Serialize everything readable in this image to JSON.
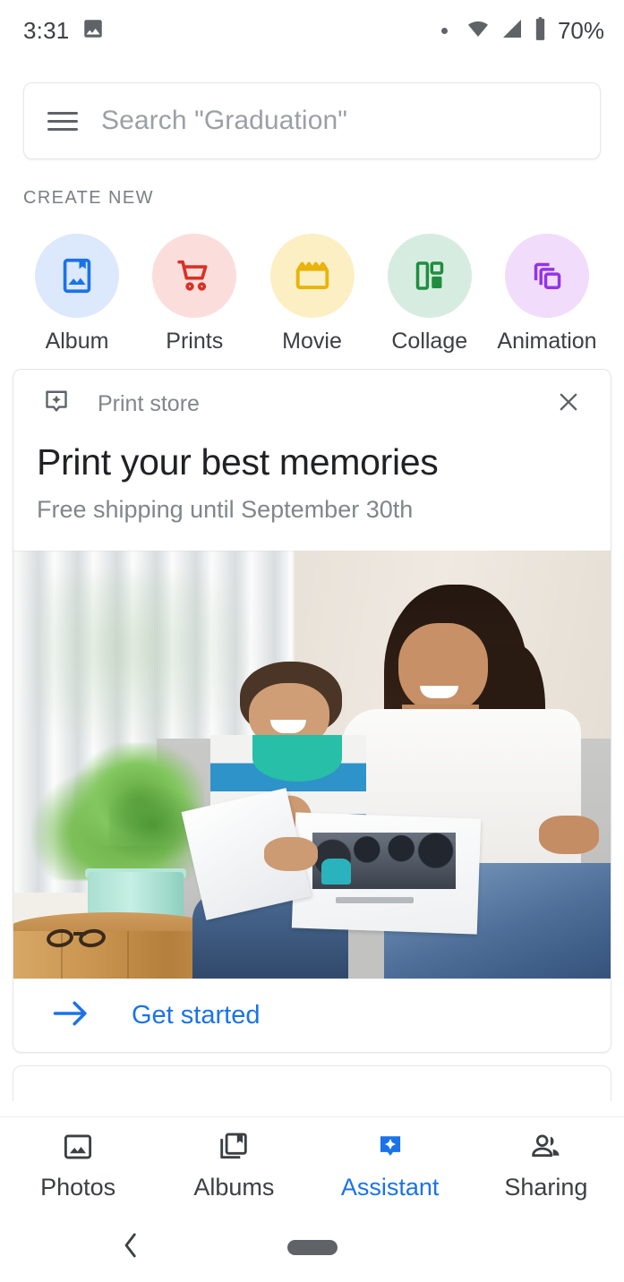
{
  "status_bar": {
    "time": "3:31",
    "photo_icon": "image-icon",
    "dot_indicator": "dot-icon",
    "wifi_icon": "wifi-icon",
    "signal_icon": "cell-signal-icon",
    "battery_icon": "battery-icon",
    "battery_percent": "70%"
  },
  "search": {
    "menu_icon": "hamburger-menu-icon",
    "placeholder": "Search \"Graduation\""
  },
  "create_new": {
    "section_label": "CREATE NEW",
    "items": [
      {
        "label": "Album",
        "icon": "album-bookmark-icon",
        "bg": "#dce8fb",
        "fg": "#1a73e8"
      },
      {
        "label": "Prints",
        "icon": "shopping-cart-icon",
        "bg": "#fbdedc",
        "fg": "#d93025"
      },
      {
        "label": "Movie",
        "icon": "clapperboard-icon",
        "bg": "#fdefc4",
        "fg": "#eab308"
      },
      {
        "label": "Collage",
        "icon": "collage-grid-icon",
        "bg": "#d7ece0",
        "fg": "#1e8e3e"
      },
      {
        "label": "Animation",
        "icon": "stacked-frames-icon",
        "bg": "#f1dcfb",
        "fg": "#9334e6"
      }
    ]
  },
  "card": {
    "source_icon": "assistant-badge-outline-icon",
    "source": "Print store",
    "close_icon": "close-icon",
    "title": "Print your best memories",
    "subtitle": "Free shipping until September 30th",
    "photo_alt": "Woman and boy sitting on a gray sofa looking at a printed photo book, with a fern on a wooden stump table",
    "cta_icon": "arrow-right-icon",
    "cta_label": "Get started"
  },
  "bottom_nav": {
    "active": "Assistant",
    "accent_color": "#1a73e8",
    "items": [
      {
        "label": "Photos",
        "icon": "photo-frame-icon"
      },
      {
        "label": "Albums",
        "icon": "albums-book-icon"
      },
      {
        "label": "Assistant",
        "icon": "assistant-sparkle-icon"
      },
      {
        "label": "Sharing",
        "icon": "people-group-icon"
      }
    ]
  },
  "system_nav": {
    "back_icon": "back-chevron-icon",
    "home_pill": "home-pill-handle"
  }
}
